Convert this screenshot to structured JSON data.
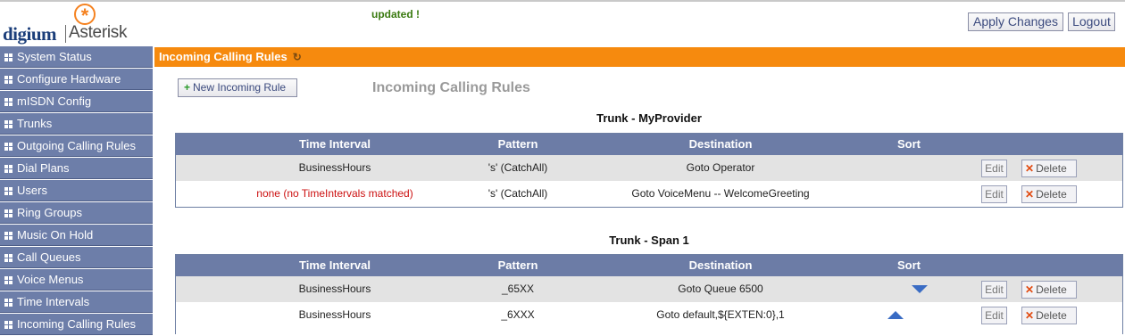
{
  "header": {
    "logo_left": "digium",
    "logo_right": "Asterisk",
    "status_message": "updated !",
    "apply_label": "Apply Changes",
    "logout_label": "Logout"
  },
  "sidebar": {
    "items": [
      {
        "label": "System Status"
      },
      {
        "label": "Configure Hardware"
      },
      {
        "label": "mISDN Config"
      },
      {
        "label": "Trunks"
      },
      {
        "label": "Outgoing Calling Rules"
      },
      {
        "label": "Dial Plans"
      },
      {
        "label": "Users"
      },
      {
        "label": "Ring Groups"
      },
      {
        "label": "Music On Hold"
      },
      {
        "label": "Call Queues"
      },
      {
        "label": "Voice Menus"
      },
      {
        "label": "Time Intervals"
      },
      {
        "label": "Incoming Calling Rules"
      }
    ]
  },
  "main": {
    "page_title": "Incoming Calling Rules",
    "new_rule_label": "New Incoming Rule",
    "section_title": "Incoming Calling Rules",
    "columns": {
      "time_interval": "Time Interval",
      "pattern": "Pattern",
      "destination": "Destination",
      "sort": "Sort"
    },
    "edit_label": "Edit",
    "delete_label": "Delete",
    "trunks": [
      {
        "title": "Trunk - MyProvider",
        "rows": [
          {
            "time_interval": "BusinessHours",
            "pattern": "'s' (CatchAll)",
            "destination": "Goto Operator"
          },
          {
            "time_interval": "none (no TimeIntervals matched)",
            "pattern": "'s' (CatchAll)",
            "destination": "Goto VoiceMenu -- WelcomeGreeting"
          }
        ]
      },
      {
        "title": "Trunk - Span 1",
        "rows": [
          {
            "time_interval": "BusinessHours",
            "pattern": "_65XX",
            "destination": "Goto Queue 6500"
          },
          {
            "time_interval": "BusinessHours",
            "pattern": "_6XXX",
            "destination": "Goto default,${EXTEN:0},1"
          }
        ]
      }
    ]
  },
  "colors": {
    "title_bar": "#f68a0e",
    "sidebar": "#6d7ea9",
    "table_header": "#6c7ca6",
    "status_ok": "#3a7a10",
    "no_match": "#cc1111"
  }
}
